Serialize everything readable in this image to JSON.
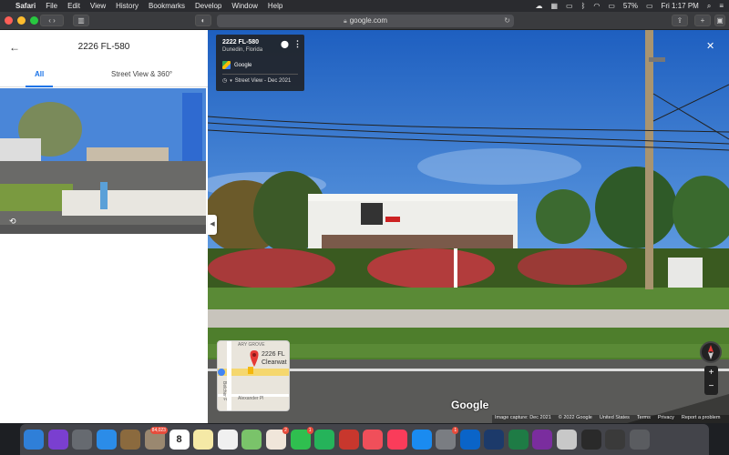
{
  "menubar": {
    "items": [
      "Safari",
      "File",
      "Edit",
      "View",
      "History",
      "Bookmarks",
      "Develop",
      "Window",
      "Help"
    ],
    "battery": "57%",
    "clock": "Fri 1:17 PM"
  },
  "toolbar": {
    "url": "google.com"
  },
  "left_panel": {
    "title": "2226 FL-580",
    "tabs": [
      {
        "label": "All",
        "active": true
      },
      {
        "label": "Street View & 360°",
        "active": false
      }
    ]
  },
  "infocard": {
    "address": "2222 FL-580",
    "city": "Dunedin, Florida",
    "source": "Google",
    "date_label": "Street View - Dec 2021"
  },
  "minimap": {
    "place_label": "2226 FL",
    "place_label2": "Clearwat",
    "street1": "Belcher F",
    "street2": "Alexander Pl",
    "street3": "ARY GROVE"
  },
  "attribution": {
    "google_logo": "Google",
    "items": [
      "Image capture: Dec 2021",
      "© 2022 Google",
      "United States",
      "Terms",
      "Privacy",
      "Report a problem"
    ]
  },
  "dock": {
    "apps": [
      {
        "name": "finder",
        "color": "#2f7fd8"
      },
      {
        "name": "siri",
        "color": "#7a3fd0"
      },
      {
        "name": "launchpad",
        "color": "#666a70"
      },
      {
        "name": "safari",
        "color": "#2b8ce8"
      },
      {
        "name": "notefile",
        "color": "#8b6a3e"
      },
      {
        "name": "contacts-badge",
        "color": "#9a8870",
        "badge": "84,023"
      },
      {
        "name": "calendar",
        "color": "#ffffff",
        "text": "8"
      },
      {
        "name": "notes",
        "color": "#f5e9a6"
      },
      {
        "name": "reminders",
        "color": "#f0f0f0"
      },
      {
        "name": "maps",
        "color": "#7ac36a"
      },
      {
        "name": "photos",
        "color": "#f0e6da",
        "badge": "2"
      },
      {
        "name": "messages",
        "color": "#2fbf4f",
        "badge": "1"
      },
      {
        "name": "facetime",
        "color": "#25b35a"
      },
      {
        "name": "photobooth",
        "color": "#c8372d"
      },
      {
        "name": "news",
        "color": "#f04f5a"
      },
      {
        "name": "music",
        "color": "#fa3c5a"
      },
      {
        "name": "app-store",
        "color": "#1a8bf0"
      },
      {
        "name": "system-preferences",
        "color": "#7a7d82",
        "badge": "1"
      },
      {
        "name": "outlook",
        "color": "#0a64c8"
      },
      {
        "name": "audio",
        "color": "#1c3a6a"
      },
      {
        "name": "excel",
        "color": "#1e7b45"
      },
      {
        "name": "onenote",
        "color": "#7a2d9e"
      },
      {
        "name": "preview",
        "color": "#c8c8c8"
      },
      {
        "name": "terminal",
        "color": "#2a2a2a"
      },
      {
        "name": "display",
        "color": "#3a3a3a"
      },
      {
        "name": "trash",
        "color": "#5a5c60"
      }
    ]
  }
}
